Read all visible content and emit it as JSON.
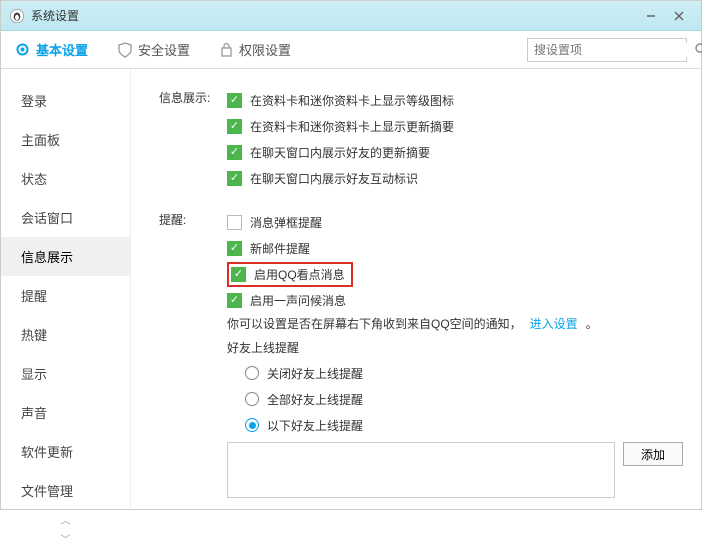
{
  "window": {
    "title": "系统设置"
  },
  "tabs": {
    "basic": "基本设置",
    "security": "安全设置",
    "privilege": "权限设置",
    "search_placeholder": "搜设置项"
  },
  "sidebar": {
    "items": [
      "登录",
      "主面板",
      "状态",
      "会话窗口",
      "信息展示",
      "提醒",
      "热键",
      "显示",
      "声音",
      "软件更新",
      "文件管理"
    ]
  },
  "section_info": {
    "label": "信息展示:",
    "opts": [
      "在资料卡和迷你资料卡上显示等级图标",
      "在资料卡和迷你资料卡上显示更新摘要",
      "在聊天窗口内展示好友的更新摘要",
      "在聊天窗口内展示好友互动标识"
    ]
  },
  "section_remind": {
    "label": "提醒:",
    "opt_popup": "消息弹框提醒",
    "opt_mail": "新邮件提醒",
    "opt_kandian": "启用QQ看点消息",
    "opt_greet": "启用一声问候消息",
    "qzone_text": "你可以设置是否在屏幕右下角收到来自QQ空间的通知，",
    "qzone_link": "进入设置",
    "period": "。",
    "friend_online_label": "好友上线提醒",
    "radio_off": "关闭好友上线提醒",
    "radio_all": "全部好友上线提醒",
    "radio_below": "以下好友上线提醒",
    "add_btn": "添加"
  }
}
